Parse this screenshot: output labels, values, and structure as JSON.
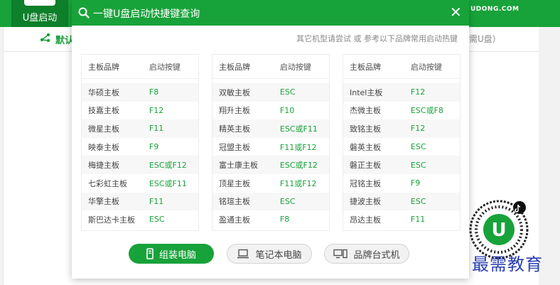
{
  "background": {
    "tab_label": "U盘启动",
    "logo_text": "UDONG.COM",
    "default_label": "默认",
    "right_hint": "需U盘）"
  },
  "watermark": "最需教育",
  "modal": {
    "title": "一键U盘启动快捷键查询",
    "subtitle": "其它机型请尝试 或 参考以下品牌常用启动热键",
    "tables": [
      {
        "headers": [
          "主板品牌",
          "启动按键"
        ],
        "rows": [
          [
            "华硕主板",
            "F8"
          ],
          [
            "技嘉主板",
            "F12"
          ],
          [
            "微星主板",
            "F11"
          ],
          [
            "映泰主板",
            "F9"
          ],
          [
            "梅捷主板",
            "ESC或F12"
          ],
          [
            "七彩虹主板",
            "ESC或F11"
          ],
          [
            "华擎主板",
            "F11"
          ],
          [
            "斯巴达卡主板",
            "ESC"
          ]
        ]
      },
      {
        "headers": [
          "主板品牌",
          "启动按键"
        ],
        "rows": [
          [
            "双敏主板",
            "ESC"
          ],
          [
            "翔升主板",
            "F10"
          ],
          [
            "精英主板",
            "ESC或F11"
          ],
          [
            "冠盟主板",
            "F11或F12"
          ],
          [
            "富士康主板",
            "ESC或F12"
          ],
          [
            "顶星主板",
            "F11或F12"
          ],
          [
            "铭瑄主板",
            "ESC"
          ],
          [
            "盈通主板",
            "F8"
          ]
        ]
      },
      {
        "headers": [
          "主板品牌",
          "启动按键"
        ],
        "rows": [
          [
            "Intel主板",
            "F12"
          ],
          [
            "杰微主板",
            "ESC或F8"
          ],
          [
            "致铭主板",
            "F12"
          ],
          [
            "磐英主板",
            "ESC"
          ],
          [
            "磐正主板",
            "ESC"
          ],
          [
            "冠铭主板",
            "F9"
          ],
          [
            "捷波主板",
            "ESC"
          ],
          [
            "昂达主板",
            "F11"
          ]
        ]
      }
    ],
    "buttons": {
      "desktop": "组装电脑",
      "laptop": "笔记本电脑",
      "brand_pc": "品牌台式机"
    }
  },
  "colors": {
    "accent": "#18a23a",
    "watermark": "#2a3eb1"
  },
  "icons": {
    "search": "search-icon",
    "close": "close-icon",
    "desktop": "desktop-tower-icon",
    "laptop": "laptop-icon",
    "brand_pc": "monitor-tower-icon",
    "default": "share-nodes-icon"
  }
}
